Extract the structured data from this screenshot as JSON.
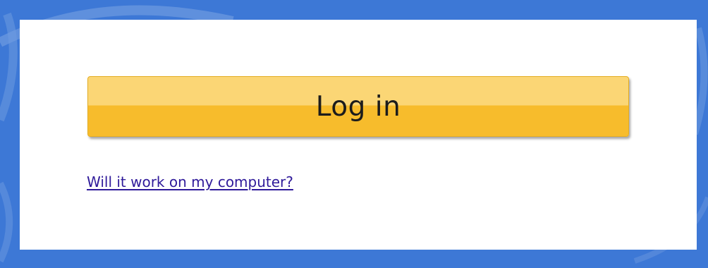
{
  "login": {
    "button_label": "Log in"
  },
  "help": {
    "link_text": "Will it work on my computer?"
  },
  "colors": {
    "background_blue": "#3d78d6",
    "button_yellow": "#f7bc2c",
    "button_highlight": "#fbd675",
    "link_color": "#2f1a9a"
  }
}
